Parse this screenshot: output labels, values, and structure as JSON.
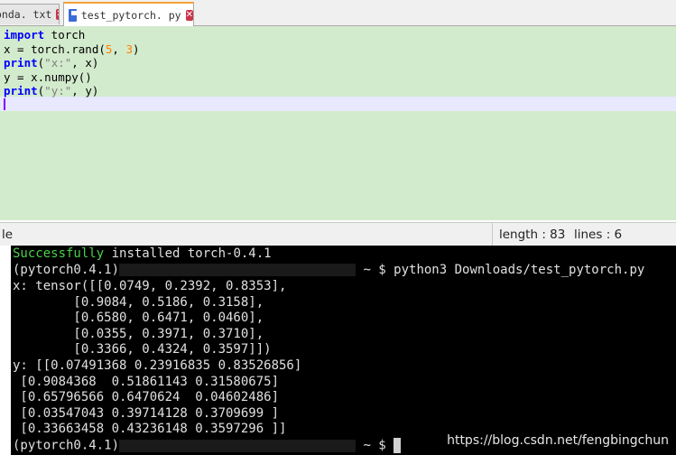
{
  "tabs": [
    {
      "label": "onda. txt",
      "active": false
    },
    {
      "label": "test_pytorch. py",
      "active": true
    }
  ],
  "code_lines": [
    {
      "parts": [
        {
          "t": "import",
          "c": "kw"
        },
        {
          "t": " torch",
          "c": ""
        }
      ]
    },
    {
      "parts": [
        {
          "t": "x = torch.rand(",
          "c": ""
        },
        {
          "t": "5",
          "c": "num"
        },
        {
          "t": ", ",
          "c": ""
        },
        {
          "t": "3",
          "c": "num"
        },
        {
          "t": ")",
          "c": ""
        }
      ]
    },
    {
      "parts": [
        {
          "t": "print",
          "c": "kw"
        },
        {
          "t": "(",
          "c": ""
        },
        {
          "t": "\"x:\"",
          "c": "str"
        },
        {
          "t": ", x)",
          "c": ""
        }
      ]
    },
    {
      "parts": [
        {
          "t": "y = x.numpy()",
          "c": ""
        }
      ]
    },
    {
      "parts": [
        {
          "t": "print",
          "c": "kw"
        },
        {
          "t": "(",
          "c": ""
        },
        {
          "t": "\"y:\"",
          "c": "str"
        },
        {
          "t": ", y)",
          "c": ""
        }
      ]
    }
  ],
  "statusbar": {
    "left": "le",
    "length": "length : 83",
    "lines": "lines : 6"
  },
  "terminal": {
    "success_word": "Successfully",
    "success_rest": " installed torch-0.4.1",
    "prompt1_env": "(pytorch0.4.1)",
    "prompt1_tail": " ~ $ python3 Downloads/test_pytorch.py",
    "output": [
      "x: tensor([[0.0749, 0.2392, 0.8353],",
      "        [0.9084, 0.5186, 0.3158],",
      "        [0.6580, 0.6471, 0.0460],",
      "        [0.0355, 0.3971, 0.3710],",
      "        [0.3366, 0.4324, 0.3597]])",
      "y: [[0.07491368 0.23916835 0.83526856]",
      " [0.9084368  0.51861143 0.31580675]",
      " [0.65796566 0.6470624  0.04602486]",
      " [0.03547043 0.39714128 0.3709699 ]",
      " [0.33663458 0.43236148 0.3597296 ]]"
    ],
    "prompt2_env": "(pytorch0.4.1)",
    "prompt2_tail": " ~ $ "
  },
  "watermark": "https://blog.csdn.net/fengbingchun"
}
